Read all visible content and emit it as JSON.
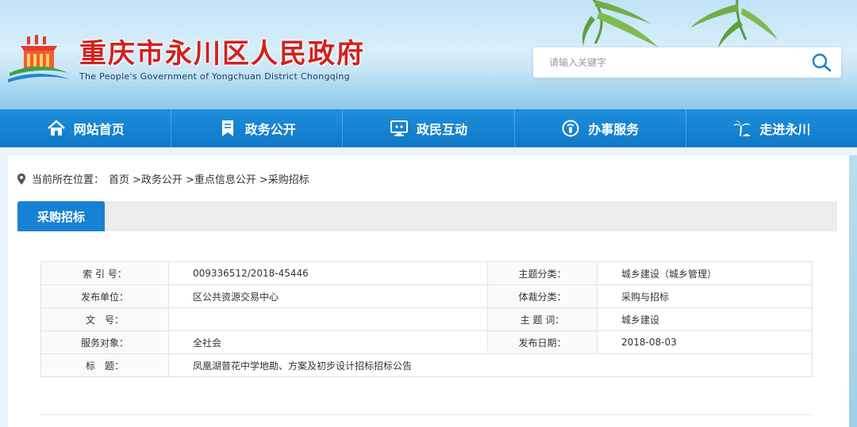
{
  "header": {
    "title": "重庆市永川区人民政府",
    "subtitle": "The People's Government of Yongchuan District Chongqing",
    "search_placeholder": "请输入关键字"
  },
  "nav": {
    "items": [
      {
        "label": "网站首页",
        "icon": "home-icon"
      },
      {
        "label": "政务公开",
        "icon": "bookmark-icon"
      },
      {
        "label": "政民互动",
        "icon": "monitor-icon"
      },
      {
        "label": "办事服务",
        "icon": "service-icon"
      },
      {
        "label": "走进永川",
        "icon": "palm-tree-icon"
      }
    ]
  },
  "breadcrumb": {
    "prefix": "当前所在位置：",
    "items": [
      "首页",
      ">政务公开",
      ">重点信息公开",
      ">采购招标"
    ]
  },
  "section": {
    "tab_label": "采购招标"
  },
  "info_table": {
    "rows": [
      {
        "label": "索 引 号：",
        "value": "009336512/2018-45446",
        "label2": "主题分类：",
        "value2": "城乡建设（城乡管理）"
      },
      {
        "label": "发布单位：",
        "value": "区公共资源交易中心",
        "label2": "体裁分类：",
        "value2": "采购与招标"
      },
      {
        "label": "文　号：",
        "value": "",
        "label2": "主 题 词：",
        "value2": "城乡建设"
      },
      {
        "label": "服务对象：",
        "value": "全社会",
        "label2": "发布日期：",
        "value2": "2018-08-03"
      }
    ],
    "title_row": {
      "label": "标　题：",
      "value": "凤凰湖普花中学地勘、方案及初步设计招标招标公告"
    }
  },
  "colors": {
    "title_red": "#d3201e",
    "nav_blue": "#1682d4",
    "section_tab_blue": "#1682d4"
  }
}
